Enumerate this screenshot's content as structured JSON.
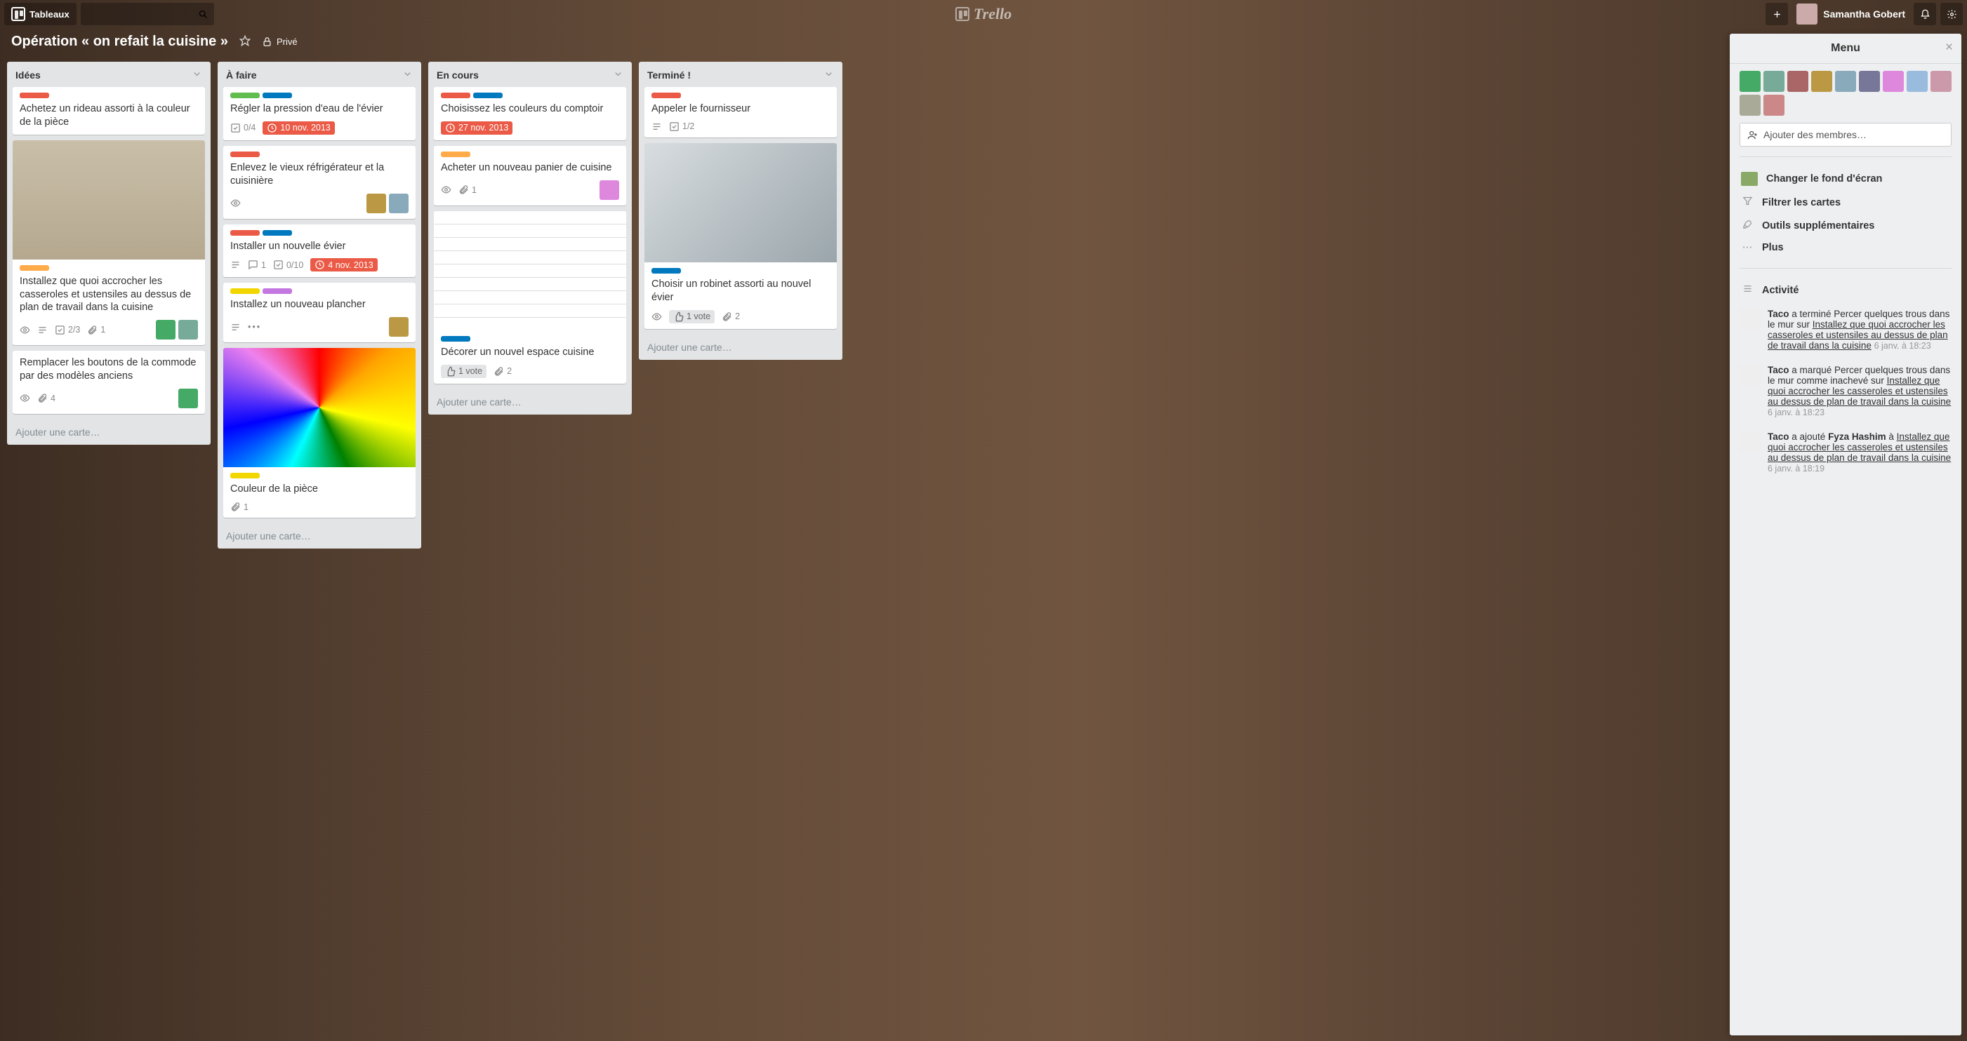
{
  "header": {
    "boards_label": "Tableaux",
    "user_name": "Samantha Gobert",
    "logo_text": "Trello"
  },
  "board": {
    "name": "Opération « on refait la cuisine »",
    "privacy": "Privé"
  },
  "lists": [
    {
      "name": "Idées",
      "add_text": "Ajouter une carte…",
      "cards": [
        {
          "labels": [
            "lred"
          ],
          "title": "Achetez un rideau assorti à la couleur de la pièce"
        },
        {
          "image": "pots",
          "labels": [
            "lorange"
          ],
          "title": "Installez que quoi accrocher les casseroles et ustensiles au dessus de plan de travail dans la cuisine",
          "badges": {
            "eye": true,
            "desc": true,
            "attach": "1",
            "check": "2/3"
          },
          "members": 2
        },
        {
          "title": "Remplacer les boutons de la commode par des modèles anciens",
          "badges": {
            "eye": true,
            "attach": "4"
          },
          "members": 1
        }
      ]
    },
    {
      "name": "À faire",
      "add_text": "Ajouter une carte…",
      "cards": [
        {
          "labels": [
            "lgreen",
            "lblue"
          ],
          "title": "Régler la pression d'eau de l'évier",
          "badges": {
            "check": "0/4",
            "due": "10 nov. 2013",
            "due_red": true
          }
        },
        {
          "labels": [
            "lred"
          ],
          "title": "Enlevez le vieux réfrigérateur et la cuisinière",
          "badges": {
            "eye": true
          },
          "members": 2
        },
        {
          "labels": [
            "lred",
            "lblue"
          ],
          "title": "Installer un nouvelle évier",
          "badges": {
            "desc": true,
            "comment": "1",
            "check": "0/10",
            "due": "4 nov. 2013",
            "due_red": true
          }
        },
        {
          "labels": [
            "lyellow",
            "lpurple"
          ],
          "title": "Installez un nouveau plancher",
          "badges": {
            "desc": true,
            "more": true
          },
          "members": 1
        },
        {
          "image": "colors",
          "labels": [
            "lyellow"
          ],
          "title": "Couleur de la pièce",
          "badges": {
            "attach": "1"
          }
        }
      ]
    },
    {
      "name": "En cours",
      "add_text": "Ajouter une carte…",
      "cards": [
        {
          "labels": [
            "lred",
            "lblue"
          ],
          "title": "Choisissez les couleurs du comptoir",
          "badges": {
            "due": "27 nov. 2013",
            "due_red": true
          }
        },
        {
          "labels": [
            "lorange"
          ],
          "title": "Acheter un nouveau panier de cuisine",
          "badges": {
            "eye": true,
            "attach": "1"
          },
          "members": 1
        },
        {
          "image": "plan",
          "labels": [
            "lblue"
          ],
          "title": "Décorer un nouvel espace cuisine",
          "badges": {
            "vote": "1 vote",
            "attach": "2"
          }
        }
      ]
    },
    {
      "name": "Terminé !",
      "add_text": "Ajouter une carte…",
      "cards": [
        {
          "labels": [
            "lred"
          ],
          "title": "Appeler le fournisseur",
          "badges": {
            "desc": true,
            "check": "1/2"
          }
        },
        {
          "image": "faucet",
          "labels": [
            "lblue"
          ],
          "title": "Choisir un robinet assorti au nouvel évier",
          "badges": {
            "eye": true,
            "vote": "1 vote",
            "attach": "2"
          }
        }
      ]
    }
  ],
  "menu": {
    "title": "Menu",
    "add_members": "Ajouter des membres…",
    "change_bg": "Changer le fond d'écran",
    "filter": "Filtrer les cartes",
    "powerups": "Outils supplémentaires",
    "more": "Plus",
    "activity_label": "Activité",
    "member_count": 11,
    "activity": [
      {
        "user": "Taco",
        "text_before": " a terminé Percer quelques trous dans le mur sur ",
        "link": "Installez que quoi accrocher les casseroles et ustensiles au dessus de plan de travail dans la cuisine",
        "ts": "6 janv. à 18:23"
      },
      {
        "user": "Taco",
        "text_before": " a marqué Percer quelques trous dans le mur comme inachevé sur ",
        "link": "Installez que quoi accrocher les casseroles et ustensiles au dessus de plan de travail dans la cuisine",
        "ts": "6 janv. à 18:23"
      },
      {
        "user": "Taco",
        "text_before": " a ajouté ",
        "bold2": "Fyza Hashim",
        "text_mid": " à ",
        "link": "Installez que quoi accrocher les casseroles et ustensiles au dessus de plan de travail dans la cuisine",
        "ts": "6 janv. à 18:19"
      }
    ]
  }
}
